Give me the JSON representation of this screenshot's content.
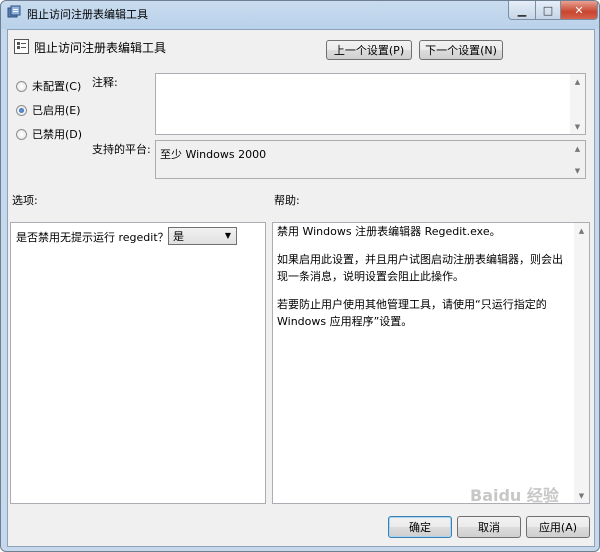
{
  "window": {
    "title": "阻止访问注册表编辑工具",
    "min_symbol": "▁",
    "max_symbol": "□",
    "close_symbol": "✕"
  },
  "header": {
    "setting_name": "阻止访问注册表编辑工具",
    "prev_button": "上一个设置(P)",
    "next_button": "下一个设置(N)"
  },
  "state": {
    "options": [
      {
        "label": "未配置(C)",
        "selected": false
      },
      {
        "label": "已启用(E)",
        "selected": true
      },
      {
        "label": "已禁用(D)",
        "selected": false
      }
    ]
  },
  "comment": {
    "label": "注释:",
    "value": ""
  },
  "platform": {
    "label": "支持的平台:",
    "value": "至少 Windows 2000"
  },
  "options_panel": {
    "label": "选项:",
    "question": "是否禁用无提示运行 regedit？",
    "dropdown_value": "是"
  },
  "help_panel": {
    "label": "帮助:",
    "paragraphs": [
      "禁用 Windows 注册表编辑器 Regedit.exe。",
      "如果启用此设置，并且用户试图启动注册表编辑器，则会出现一条消息，说明设置会阻止此操作。",
      "若要防止用户使用其他管理工具，请使用“只运行指定的 Windows 应用程序”设置。"
    ]
  },
  "footer": {
    "ok_button": "确定",
    "cancel_button": "取消",
    "apply_button": "应用(A)"
  },
  "watermark": {
    "text": "Baidu 经验"
  },
  "colors": {
    "title_bar": "#b9d1ea",
    "close_button": "#c8452f",
    "client_bg": "#f0f0f0"
  }
}
